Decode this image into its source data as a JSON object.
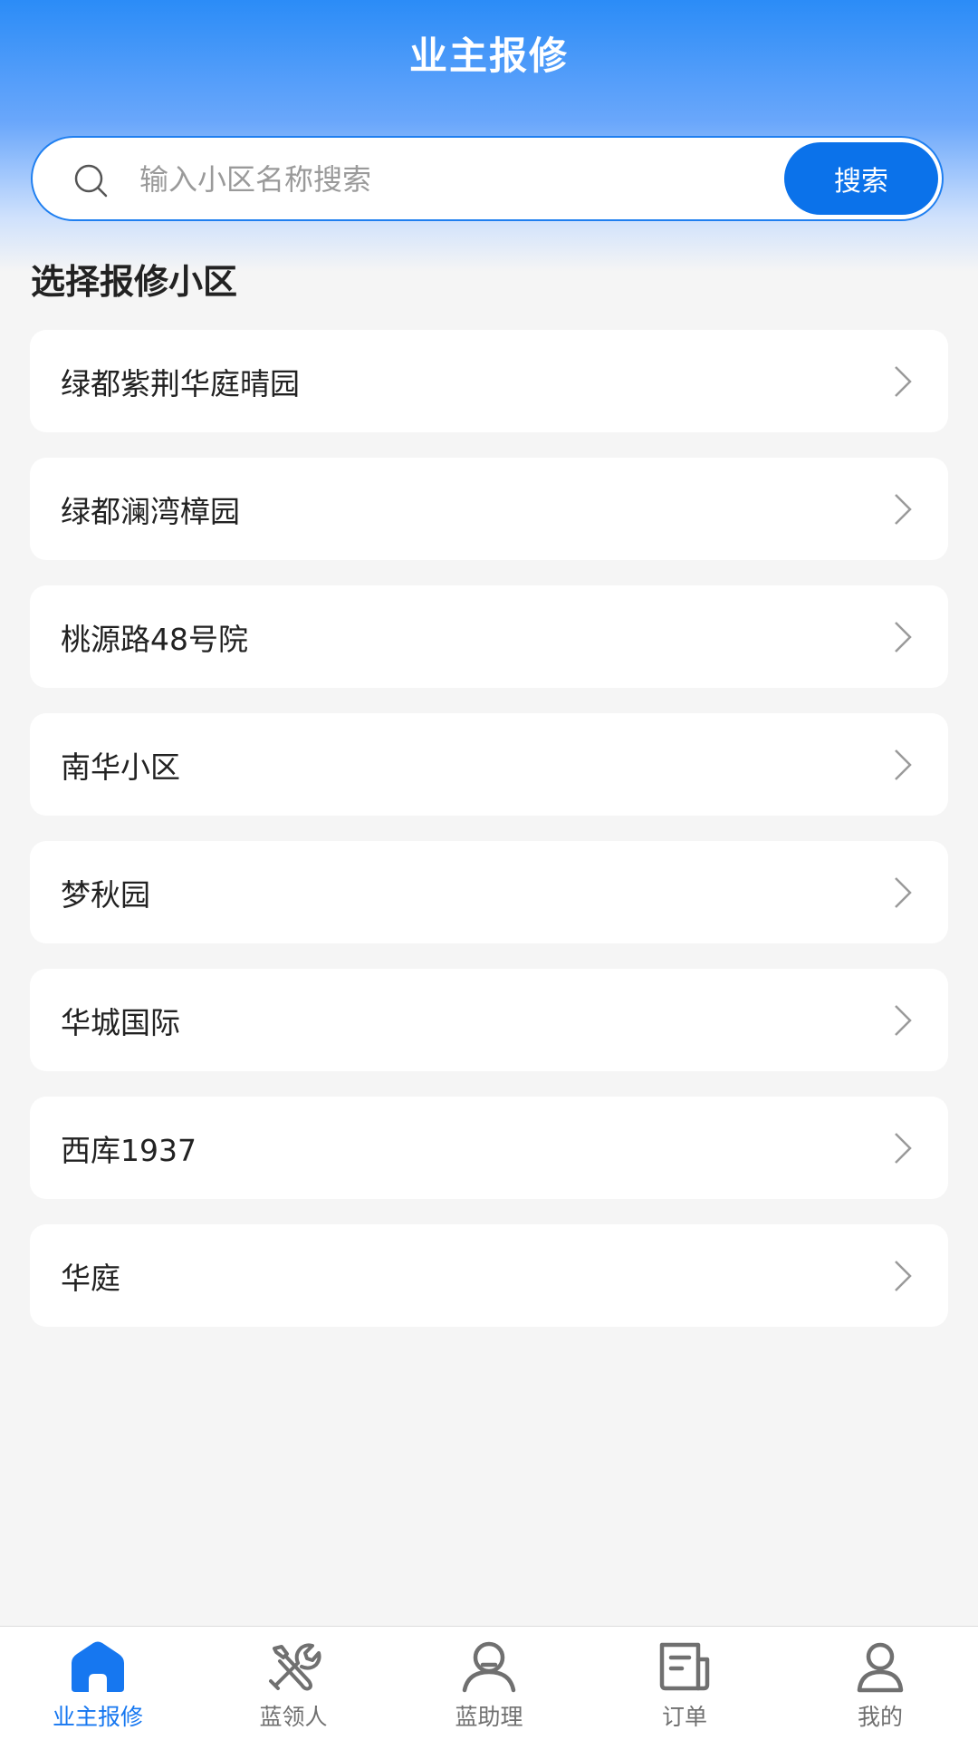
{
  "header": {
    "title": "业主报修"
  },
  "search": {
    "placeholder": "输入小区名称搜索",
    "button_label": "搜索"
  },
  "section": {
    "title": "选择报修小区"
  },
  "communities": [
    {
      "name": "绿都紫荆华庭晴园"
    },
    {
      "name": "绿都澜湾樟园"
    },
    {
      "name": "桃源路48号院"
    },
    {
      "name": "南华小区"
    },
    {
      "name": "梦秋园"
    },
    {
      "name": "华城国际"
    },
    {
      "name": "西库1937"
    },
    {
      "name": "华庭"
    }
  ],
  "tabbar": {
    "tabs": [
      {
        "label": "业主报修",
        "icon": "home-icon",
        "active": true
      },
      {
        "label": "蓝领人",
        "icon": "tools-icon",
        "active": false
      },
      {
        "label": "蓝助理",
        "icon": "assistant-icon",
        "active": false
      },
      {
        "label": "订单",
        "icon": "order-icon",
        "active": false
      },
      {
        "label": "我的",
        "icon": "user-icon",
        "active": false
      }
    ]
  },
  "colors": {
    "accent": "#1677f0",
    "header_gradient_top": "#2b8cf7",
    "background": "#f5f5f5"
  }
}
